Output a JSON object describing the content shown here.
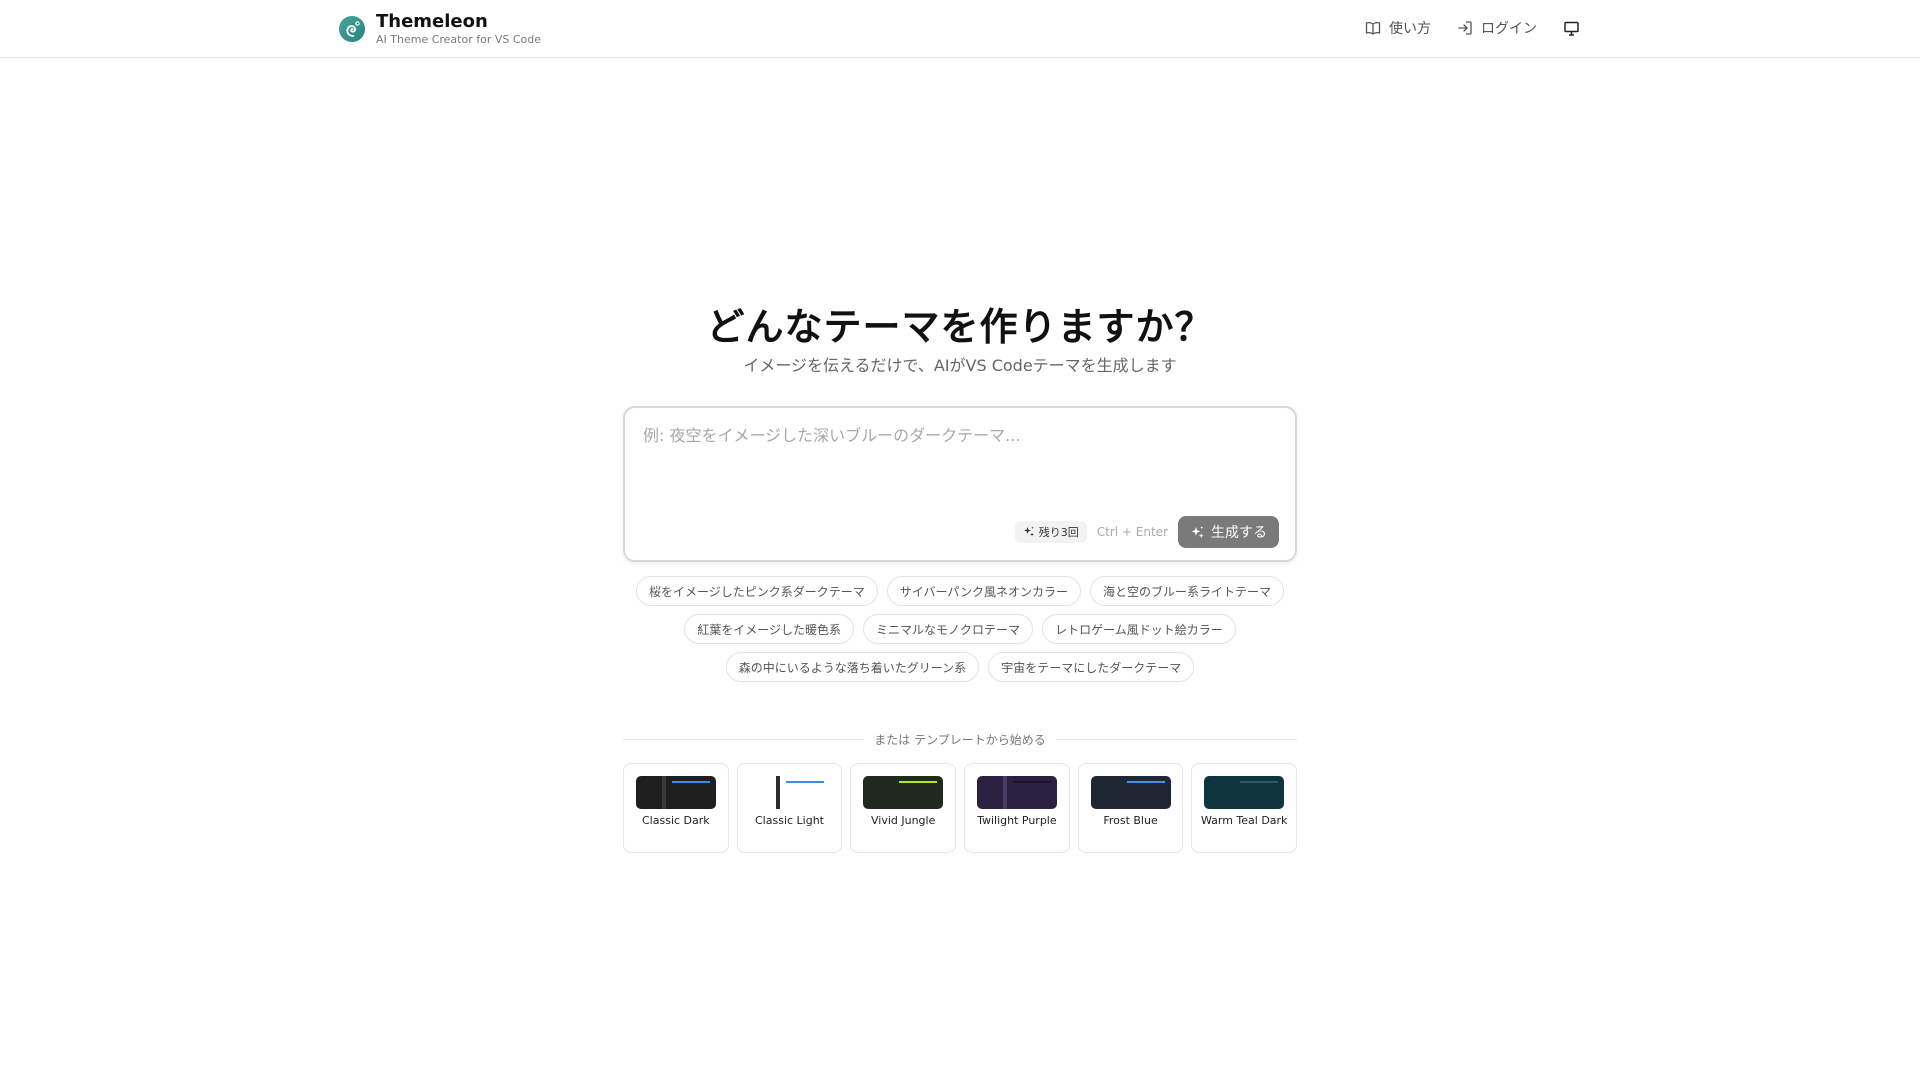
{
  "header": {
    "brand_name": "Themeleon",
    "brand_tagline": "AI Theme Creator for VS Code",
    "nav": {
      "guide_label": "使い方",
      "login_label": "ログイン"
    }
  },
  "hero": {
    "title": "どんなテーマを作りますか？",
    "subtitle": "イメージを伝えるだけで、AIがVS Codeテーマを生成します"
  },
  "prompt": {
    "value": "",
    "placeholder": "例: 夜空をイメージした深いブルーのダークテーマ...",
    "remaining_label": "残り3回",
    "shortcut_hint": "Ctrl + Enter",
    "generate_label": "生成する"
  },
  "suggestions": {
    "row1": [
      "桜をイメージしたピンク系ダークテーマ",
      "サイバーパンク風ネオンカラー",
      "海と空のブルー系ライトテーマ"
    ],
    "row2": [
      "紅葉をイメージした暖色系",
      "ミニマルなモノクロテーマ",
      "レトロゲーム風ドット絵カラー"
    ],
    "row3": [
      "森の中にいるような落ち着いたグリーン系",
      "宇宙をテーマにしたダークテーマ"
    ]
  },
  "divider": {
    "text": "または テンプレートから始める"
  },
  "templates": [
    {
      "name": "Classic Dark",
      "bg": "#1e1e1e",
      "sidebar": "#3a3a3a",
      "accent": "#3a8ee6"
    },
    {
      "name": "Classic Light",
      "bg": "#ffffff",
      "sidebar": "#2b2b2b",
      "accent": "#3a8ee6"
    },
    {
      "name": "Vivid Jungle",
      "bg": "#1d2a1c",
      "sidebar": "#1d2a1c",
      "accent": "#b5e61d"
    },
    {
      "name": "Twilight Purple",
      "bg": "#2a2040",
      "sidebar": "#4a3d63",
      "accent": "#1a1428"
    },
    {
      "name": "Frost Blue",
      "bg": "#1f2735",
      "sidebar": "#1f2735",
      "accent": "#4a90e2"
    },
    {
      "name": "Warm Teal Dark",
      "bg": "#0f3440",
      "sidebar": "#0f3440",
      "accent": "#2a5a66"
    }
  ]
}
